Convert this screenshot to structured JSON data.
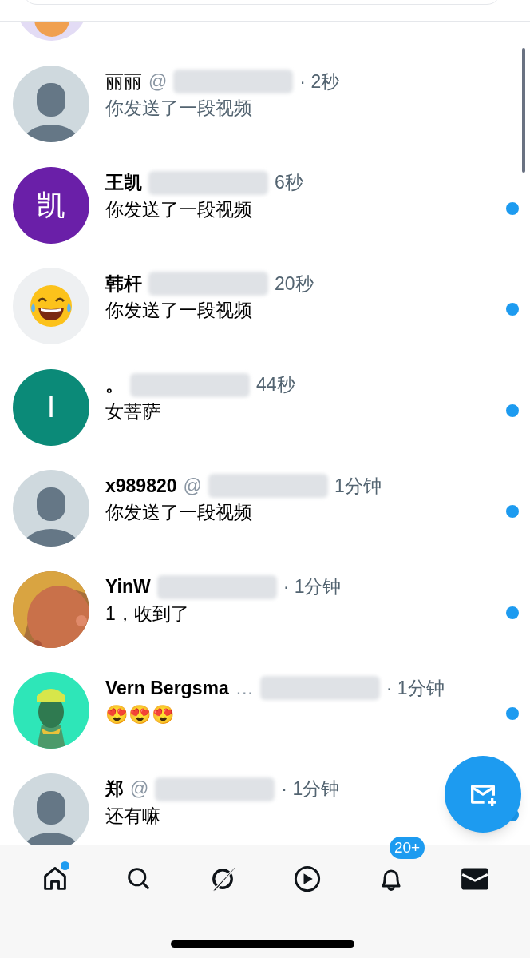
{
  "conversations": [
    {
      "avatar": {
        "kind": "default"
      },
      "name": "丽丽",
      "handle": "@",
      "time": "· 2秒",
      "message": "你发送了一段视频",
      "unread": false
    },
    {
      "avatar": {
        "kind": "letter",
        "letter": "凯",
        "color": "#6a1fa8"
      },
      "name": "王凯",
      "time": "6秒",
      "message": "你发送了一段视频",
      "unread": true
    },
    {
      "avatar": {
        "kind": "laughing"
      },
      "name": "韩杆",
      "time": "20秒",
      "message": "你发送了一段视频",
      "unread": true
    },
    {
      "avatar": {
        "kind": "letter",
        "letter": "I",
        "color": "#0b8a78"
      },
      "name": "。",
      "time": "44秒",
      "message": "女菩萨",
      "unread": true
    },
    {
      "avatar": {
        "kind": "default"
      },
      "name": "x989820",
      "handle": "@",
      "time": "1分钟",
      "message": "你发送了一段视频",
      "unread": true
    },
    {
      "name": "YinW",
      "time": "· 1分钟",
      "message": "1，收到了",
      "unread": true
    },
    {
      "name": "Vern Bergsma",
      "handle": "…",
      "time": "· 1分钟",
      "message": "😍😍😍",
      "unread": true
    },
    {
      "avatar": {
        "kind": "default"
      },
      "name": "郑",
      "handle": "@",
      "time": "· 1分钟",
      "message": "还有嘛",
      "unread": true
    }
  ],
  "nav": [
    {
      "kind": "home",
      "selected": false,
      "dot": true
    },
    {
      "kind": "search",
      "selected": false
    },
    {
      "kind": "grok",
      "selected": false
    },
    {
      "kind": "video",
      "selected": false
    },
    {
      "kind": "bell",
      "selected": false,
      "badge": "20+"
    },
    {
      "kind": "mail",
      "selected": true
    }
  ]
}
